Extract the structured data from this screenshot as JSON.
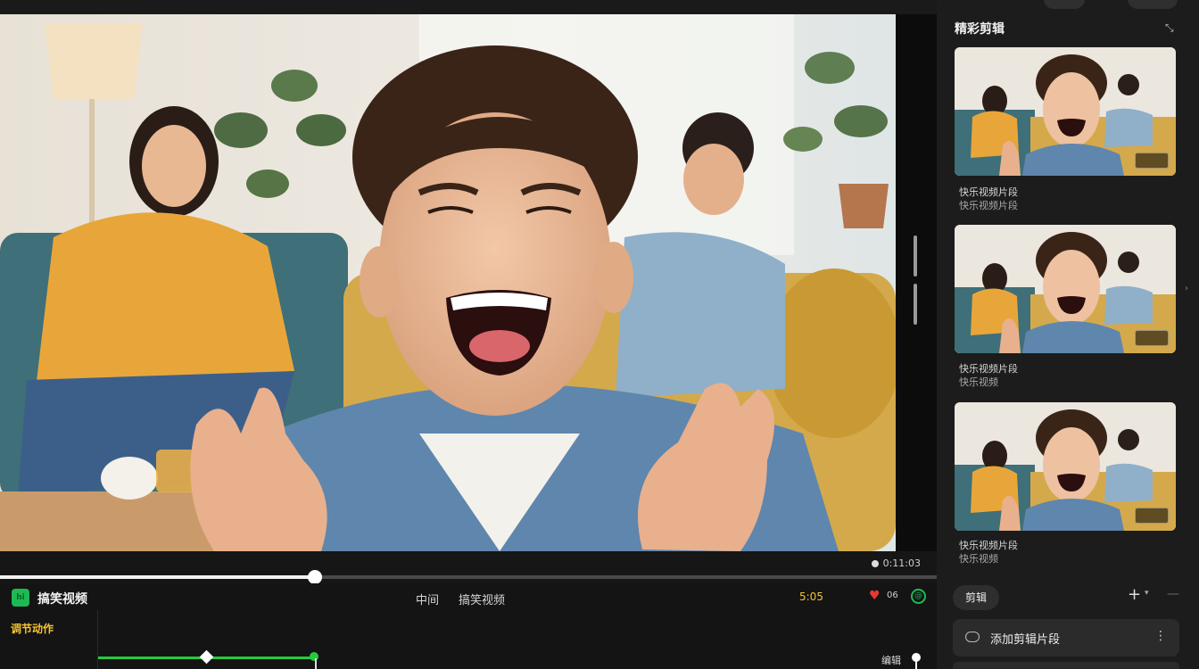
{
  "player": {
    "time_readout": "0:11:03",
    "progress": 0.336
  },
  "panel": {
    "app_badge": "hi",
    "app_title": "搞笑视频",
    "mid_label_a": "中间",
    "mid_label_b": "搞笑视频",
    "right_label": "5:05",
    "mini_label": "06",
    "ring_label": "@",
    "track_label": "调节动作",
    "pin_label": "编辑"
  },
  "sidebar": {
    "title": "精彩剪辑",
    "clips": [
      {
        "caption": "快乐视频片段",
        "subcaption": "快乐视频片段"
      },
      {
        "caption": "快乐视频片段",
        "subcaption": "快乐视频"
      },
      {
        "caption": "快乐视频片段",
        "subcaption": "快乐视频"
      }
    ],
    "chip_label": "剪辑",
    "field_label": "添加剪辑片段"
  },
  "colors": {
    "accent_green": "#1db954",
    "accent_yellow": "#f4c430",
    "heart_red": "#e53935"
  }
}
